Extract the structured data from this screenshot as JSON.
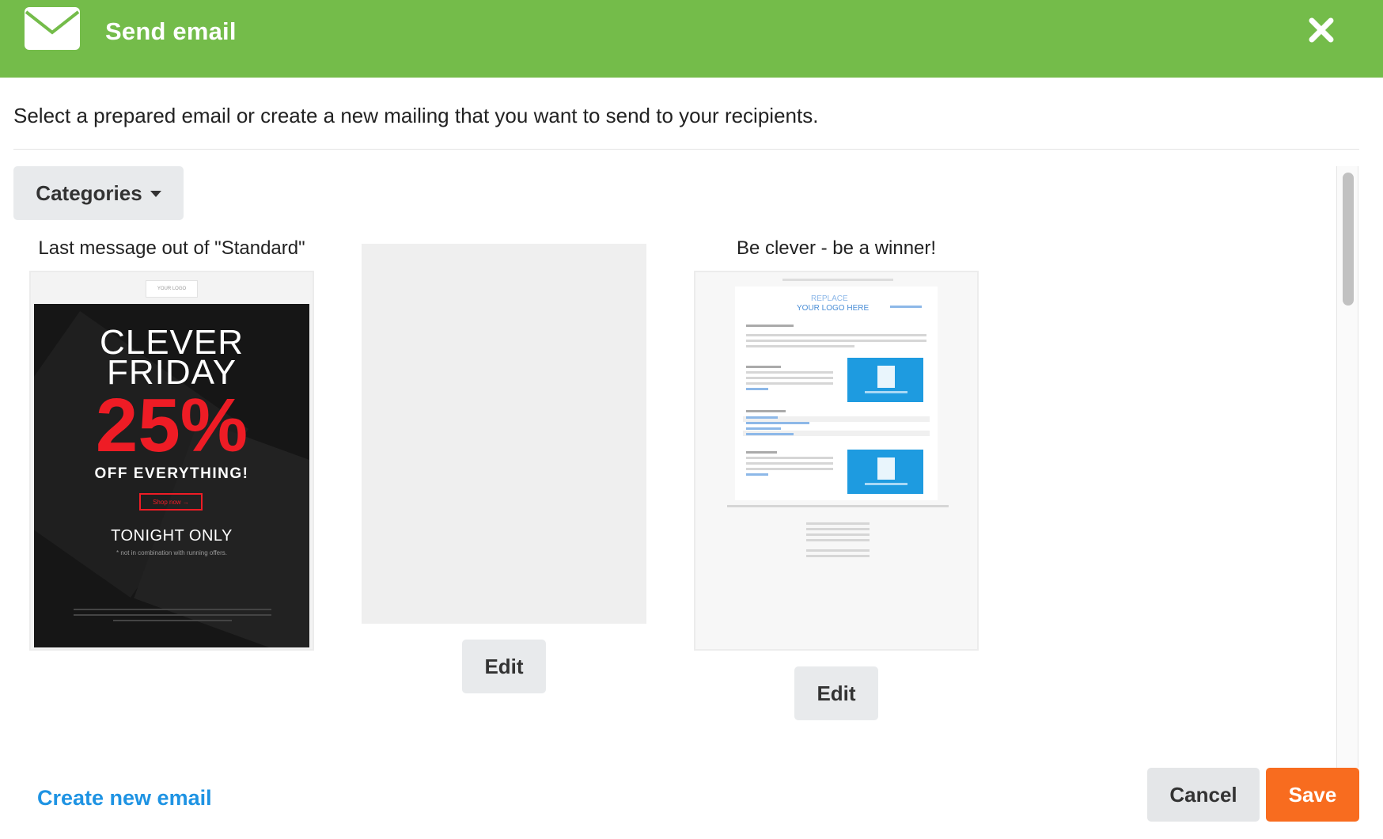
{
  "header": {
    "title": "Send email",
    "accent_color": "#74bc4a",
    "icon": "envelope-icon",
    "close_icon": "close-icon"
  },
  "intro": "Select a prepared email or create a new mailing that you want to send to your recipients.",
  "categories_label": "Categories",
  "cards": [
    {
      "title": "Last message out of \"Standard\"",
      "preview": {
        "logo": "YOUR LOGO",
        "line1": "CLEVER",
        "line2": "FRIDAY",
        "percent": "25%",
        "offer": "OFF EVERYTHING!",
        "shop": "Shop now →",
        "tonight": "TONIGHT ONLY",
        "note": "* not in combination with running offers."
      }
    },
    {
      "title": "",
      "edit_label": "Edit"
    },
    {
      "title": "Be clever - be a winner!",
      "preview": {
        "logo_line1": "REPLACE",
        "logo_line2": "YOUR LOGO HERE"
      },
      "edit_label": "Edit"
    }
  ],
  "footer": {
    "create_link": "Create new email",
    "cancel_label": "Cancel",
    "save_label": "Save",
    "save_color": "#f86c1f"
  }
}
